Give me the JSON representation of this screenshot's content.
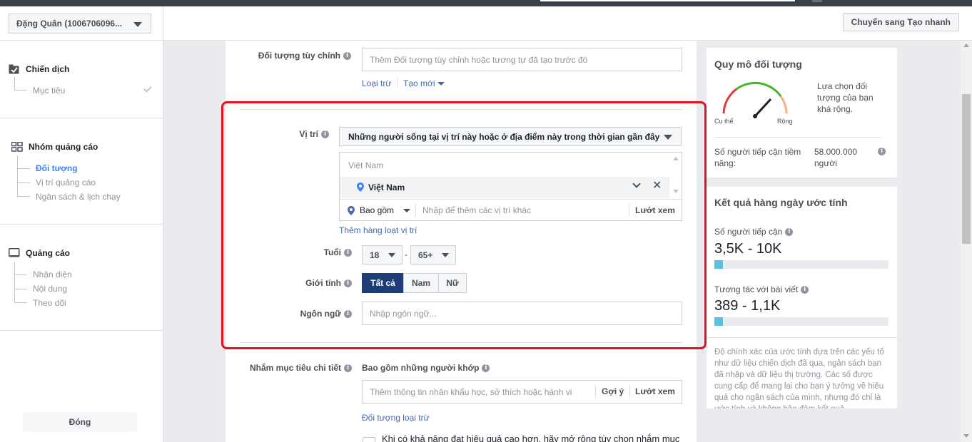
{
  "header": {
    "account_label": "Đặng Quân (1006706096...",
    "switch_button": "Chuyển sang Tạo nhanh"
  },
  "sidebar": {
    "campaign": {
      "title": "Chiến dịch",
      "items": [
        "Mục tiêu"
      ]
    },
    "adset": {
      "title": "Nhóm quảng cáo",
      "items": [
        "Đối tượng",
        "Vị trí quảng cáo",
        "Ngân sách & lịch chạy"
      ]
    },
    "ad": {
      "title": "Quảng cáo",
      "items": [
        "Nhận diện",
        "Nội dung",
        "Theo dõi"
      ]
    },
    "close_button": "Đóng"
  },
  "form": {
    "custom_audience": {
      "label": "Đối tượng tùy chỉnh",
      "placeholder": "Thêm Đối tượng tùy chỉnh hoặc tương tự đã tạo trước đó",
      "exclude_link": "Loại trừ",
      "create_link": "Tạo mới"
    },
    "location": {
      "label": "Vị trí",
      "dropdown_value": "Những người sống tại vị trí này hoặc ở địa điểm này trong thời gian gần đây",
      "country_header": "Việt Nam",
      "selected": "Việt Nam",
      "include_label": "Bao gồm",
      "add_placeholder": "Nhập để thêm các vị trí khác",
      "browse": "Lướt xem",
      "bulk_link": "Thêm hàng loạt vị trí"
    },
    "age": {
      "label": "Tuổi",
      "min": "18",
      "dash": "-",
      "max": "65+"
    },
    "gender": {
      "label": "Giới tính",
      "options": [
        "Tất cả",
        "Nam",
        "Nữ"
      ],
      "selected": "Tất cả"
    },
    "language": {
      "label": "Ngôn ngữ",
      "placeholder": "Nhập ngôn ngữ..."
    },
    "detailed_targeting": {
      "label": "Nhắm mục tiêu chi tiết",
      "include_label": "Bao gồm những người khớp",
      "placeholder": "Thêm thông tin nhân khẩu học, sở thích hoặc hành vi",
      "suggest": "Gợi ý",
      "browse": "Lướt xem",
      "exclude_link": "Đối tượng loại trừ",
      "expand_text": "Khi có khả năng đạt hiệu quả cao hơn, hãy mở rộng tùy chọn nhắm mục"
    }
  },
  "audience_size": {
    "title": "Quy mô đối tượng",
    "gauge_left": "Cụ thể",
    "gauge_right": "Rộng",
    "gauge_level": 0.75,
    "description": "Lựa chọn đối tượng của bạn khá rộng.",
    "potential_label": "Số người tiếp cận tiềm năng:",
    "potential_value": "58.000.000 người"
  },
  "daily_results": {
    "title": "Kết quả hàng ngày ước tính",
    "reach_label": "Số người tiếp cận",
    "reach_value": "3,5K - 10K",
    "reach_fill": 0.05,
    "engagement_label": "Tương tác với bài viết",
    "engagement_value": "389 - 1,1K",
    "engagement_fill": 0.05,
    "disclaimer": "Độ chính xác của ước tính dựa trên các yếu tố như dữ liệu chiến dịch đã qua, ngân sách bạn đã nhập và dữ liệu thị trường. Các số được cung cấp để mang lại cho bạn ý tưởng về hiệu quả cho ngân sách của mình, nhưng đó chỉ là ước tính và không bảo đảm kết quả."
  },
  "colors": {
    "accent": "#4080ff",
    "link": "#4267b2",
    "highlight": "#e5101f",
    "active_segment": "#1d3c78",
    "gauge_green": "#42b72a",
    "gauge_red": "#e03c3c",
    "gauge_orange": "#f7b183",
    "bar_fill": "#5bc0de"
  }
}
